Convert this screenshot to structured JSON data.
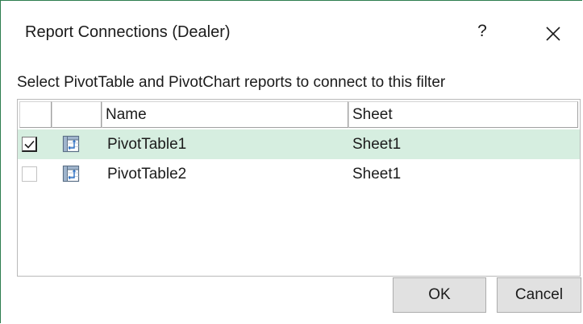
{
  "dialog": {
    "title": "Report Connections (Dealer)",
    "help_label": "?",
    "close_icon": "close-icon",
    "instruction": "Select PivotTable and PivotChart reports to connect to this filter"
  },
  "table": {
    "headers": {
      "check": "",
      "icon": "",
      "name": "Name",
      "sheet": "Sheet"
    },
    "rows": [
      {
        "checked": true,
        "name": "PivotTable1",
        "sheet": "Sheet1",
        "selected": true
      },
      {
        "checked": false,
        "name": "PivotTable2",
        "sheet": "Sheet1",
        "selected": false
      }
    ],
    "row_icon": "pivot-table-icon"
  },
  "buttons": {
    "ok": "OK",
    "cancel": "Cancel"
  },
  "colors": {
    "accent": "#2e7d4f",
    "selected_row": "#d6eee0",
    "button_face": "#e1e1e1"
  }
}
